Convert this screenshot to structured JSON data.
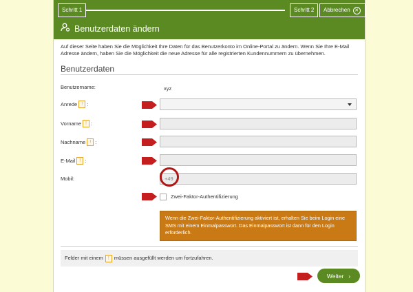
{
  "header": {
    "step1": "Schritt 1",
    "step2": "Schritt 2",
    "cancel": "Abbrechen",
    "title": "Benutzerdaten ändern"
  },
  "intro": "Auf dieser Seite haben Sie die Möglichkeit Ihre Daten für das Benutzerkonto im Online-Portal zu ändern. Wenn Sie Ihre E-Mail Adresse ändern, haben Sie die Möglichkeit die neue Adresse für alle registrierten Kundennummern zu übernehmen.",
  "section_title": "Benutzerdaten",
  "form": {
    "username_label": "Benutzername:",
    "username_value": "xyz",
    "anrede_label": "Anrede",
    "vorname_label": "Vorname",
    "nachname_label": "Nachname",
    "email_label": "E-Mail",
    "mobil_label": "Mobil:",
    "mobil_placeholder": "+49",
    "colon": ":",
    "required_mark": "!",
    "anrede_value": "",
    "vorname_value": "",
    "nachname_value": "",
    "email_value": ""
  },
  "twofa": {
    "label": "Zwei-Faktor-Authentifizierung",
    "info": "Wenn die Zwei-Faktor-Authentifizierung aktiviert ist, erhalten Sie beim Login eine SMS mit einem Einmalpasswort. Das Einmalpasswort ist dann für den Login erforderlich."
  },
  "footer": {
    "required_before": "Felder mit einem",
    "required_after": "müssen ausgefüllt werden um fortzufahren."
  },
  "next_button": "Weiter",
  "colors": {
    "brand_green": "#5b8a23",
    "marker_red": "#c41e1e",
    "info_orange": "#c97a14",
    "page_bg": "#fbfcd6"
  },
  "icons": {
    "title_icon": "user-gear-icon",
    "cancel_icon": "close-icon",
    "next_icon": "chevron-right-icon"
  }
}
